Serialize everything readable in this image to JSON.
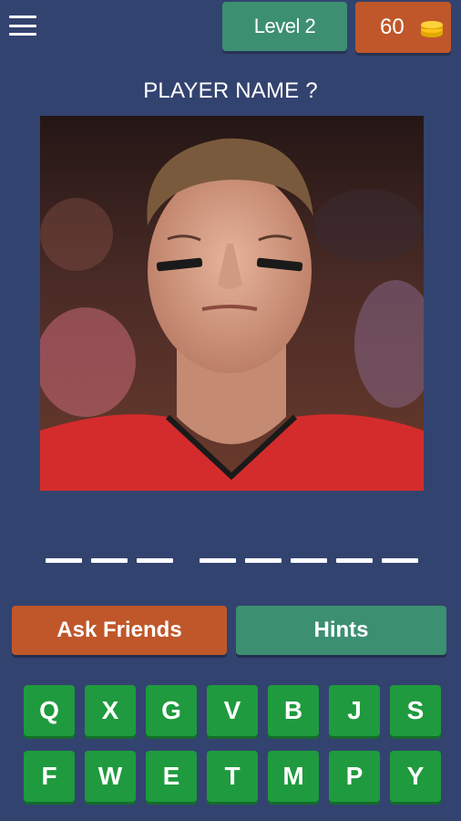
{
  "header": {
    "menu_icon": "hamburger-menu-icon",
    "level_label": "Level 2",
    "coins_count": "60",
    "coin_icon": "coin-stack-icon"
  },
  "question": {
    "prompt": "PLAYER NAME ?"
  },
  "answer": {
    "words": [
      3,
      5
    ]
  },
  "actions": {
    "ask_friends_label": "Ask Friends",
    "hints_label": "Hints"
  },
  "keyboard": {
    "row1": [
      "Q",
      "X",
      "G",
      "V",
      "B",
      "J",
      "S"
    ],
    "row2": [
      "F",
      "W",
      "E",
      "T",
      "M",
      "P",
      "Y"
    ]
  },
  "colors": {
    "background": "#33436f",
    "level_button": "#3d8f72",
    "coins_button": "#c0572a",
    "key": "#1f9a3e"
  }
}
